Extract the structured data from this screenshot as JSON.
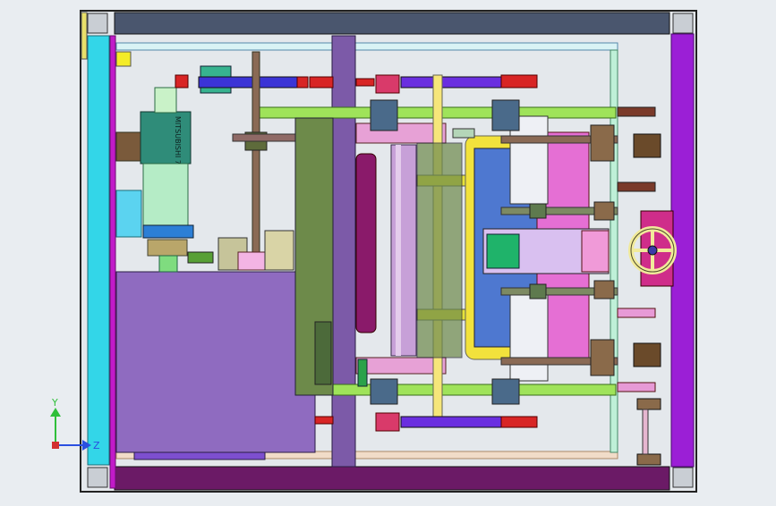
{
  "viewport": {
    "background": "#e9edf1",
    "axis_triad": {
      "y_label": "Y",
      "z_label": "Z",
      "y_color": "#2fbf3a",
      "z_color": "#2a4fe0",
      "origin_color": "#d23030"
    }
  },
  "motor": {
    "nameplate_text": "MITSUBISHI 7-SH1081-G10"
  },
  "colors": {
    "frame_top": "#4a566e",
    "frame_cyan": "#33d6e8",
    "frame_magenta": "#c21bc9",
    "frame_purple": "#7c5aa8",
    "green_rod": "#9fe35a",
    "olive_plate": "#6d8a4a",
    "yellow": "#f2e23c",
    "pink_plate": "#e56fd4",
    "blue_bar": "#5a2bd8",
    "red_part": "#d82525"
  }
}
